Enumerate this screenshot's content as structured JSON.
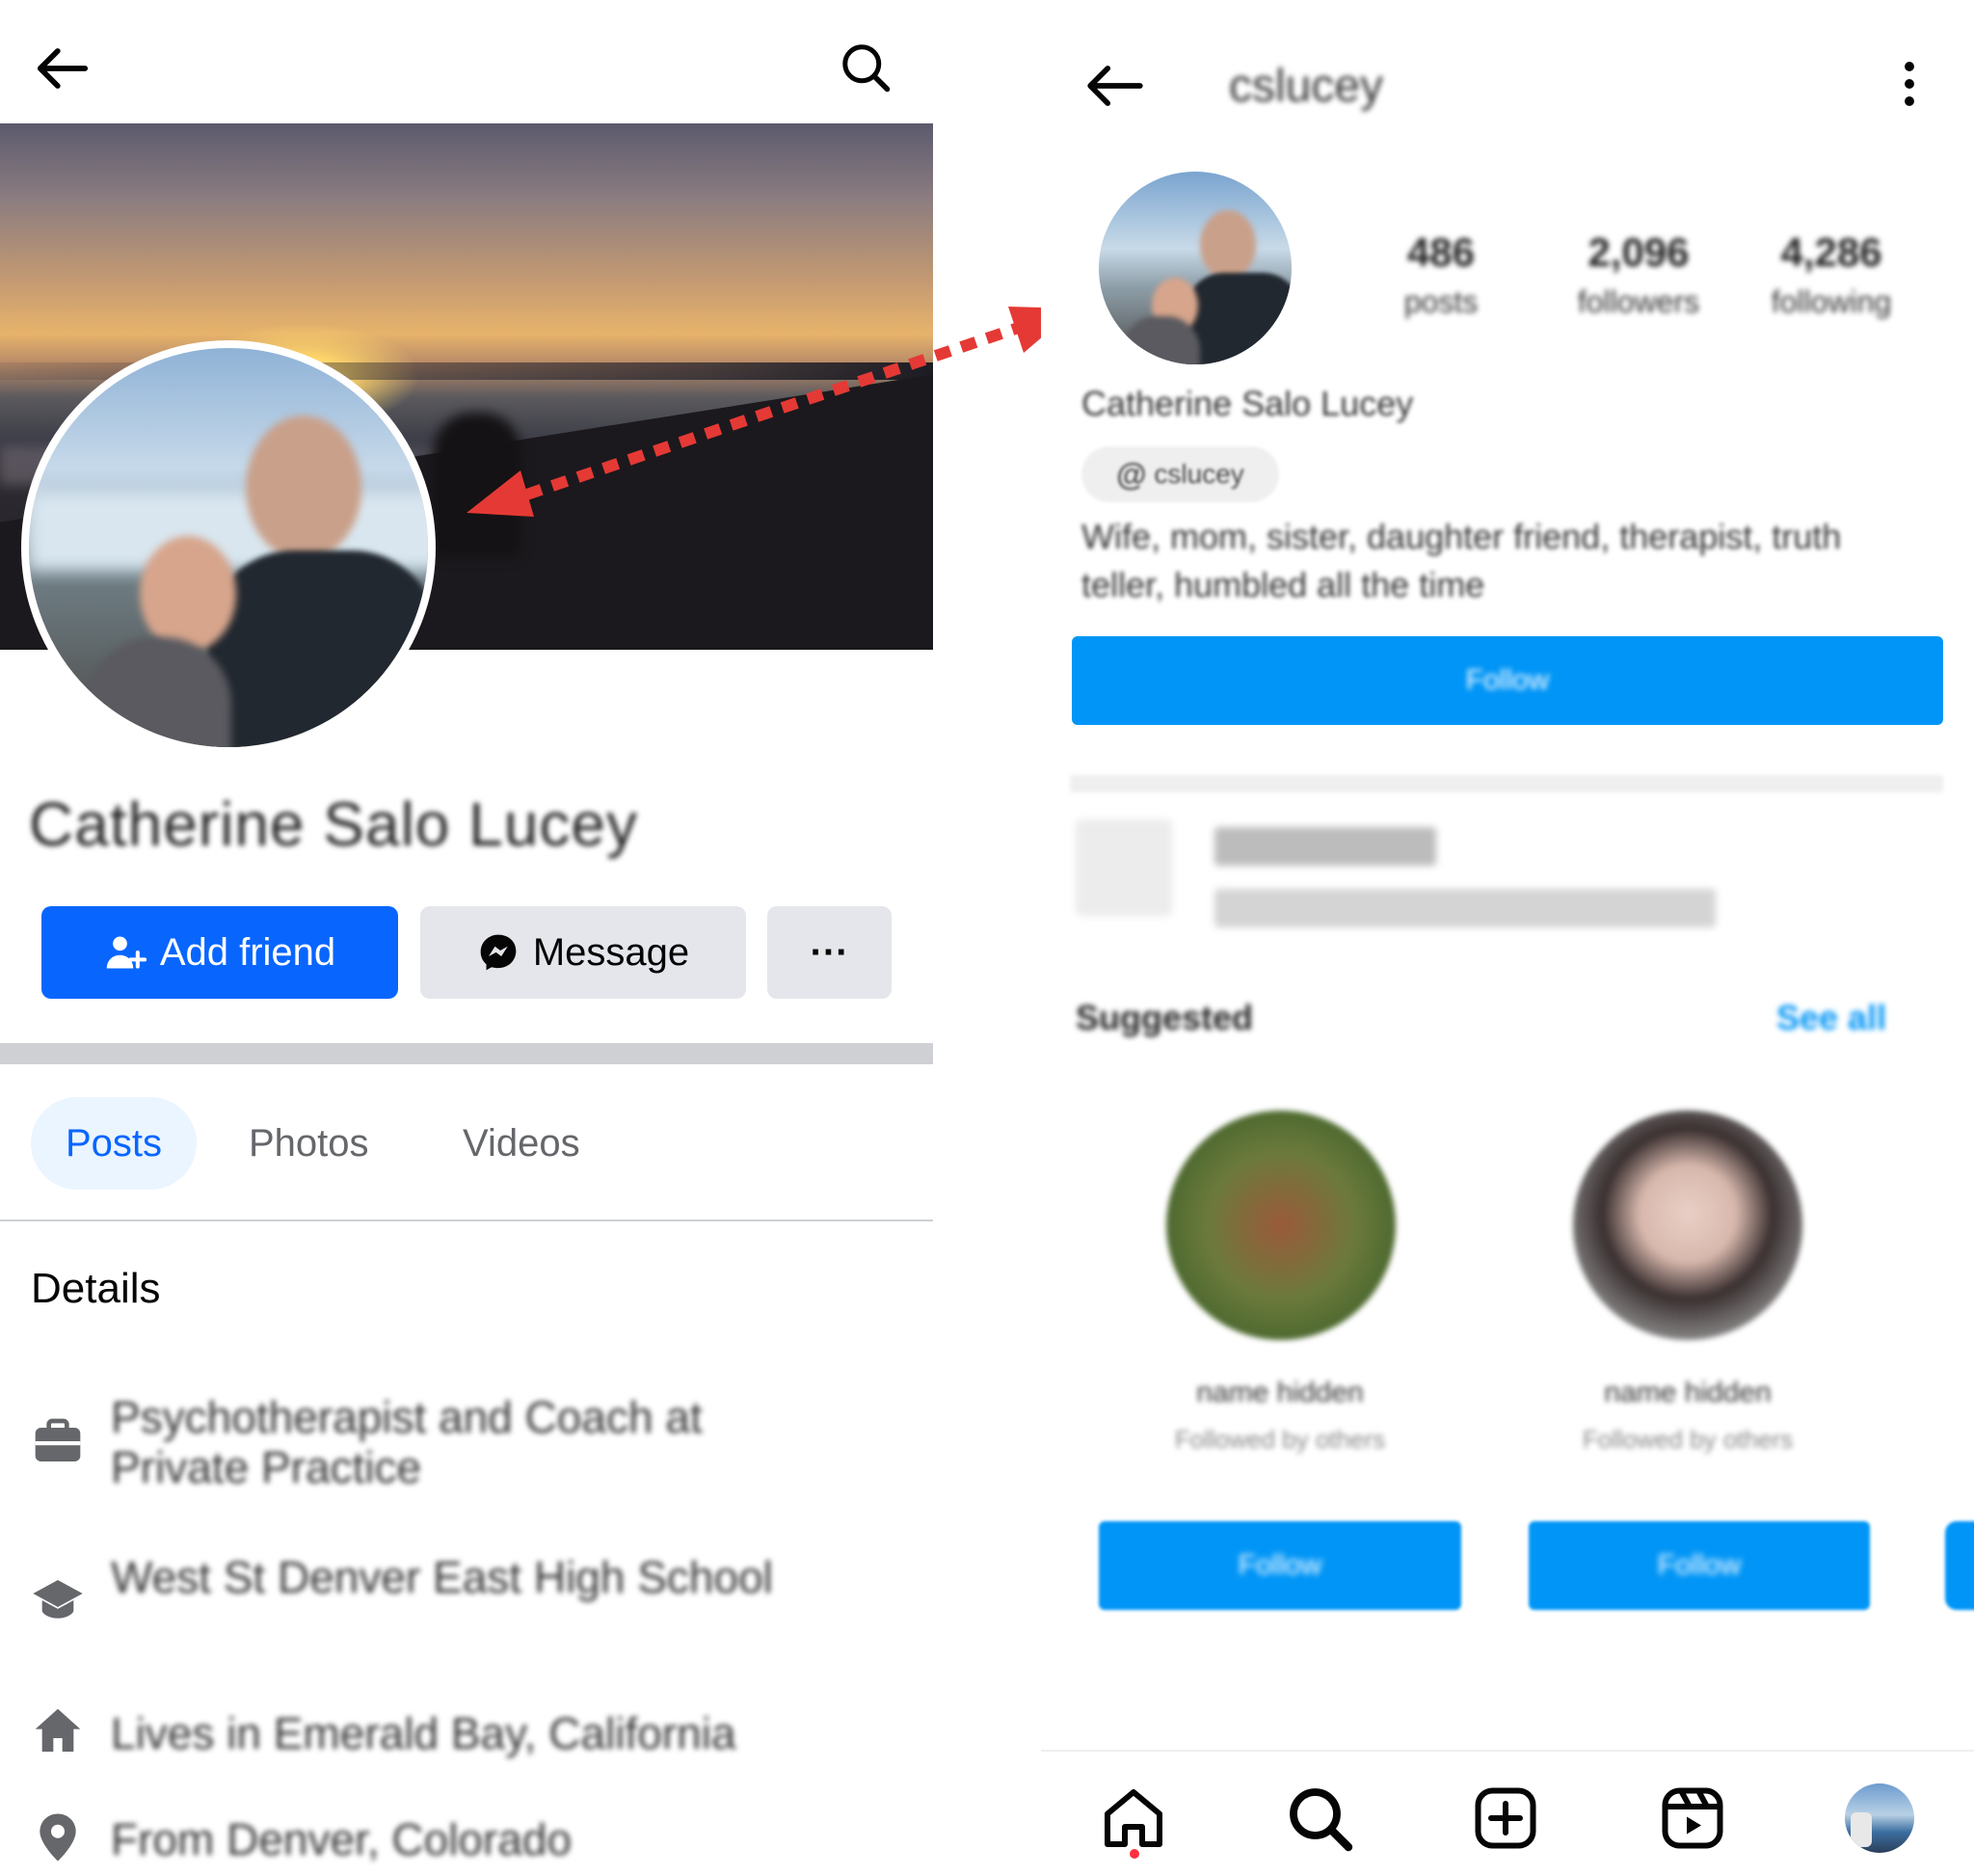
{
  "facebook": {
    "profile_name": "Catherine Salo Lucey",
    "buttons": {
      "add_friend": "Add friend",
      "message": "Message",
      "more": "···"
    },
    "tabs": [
      {
        "label": "Posts",
        "active": true
      },
      {
        "label": "Photos",
        "active": false
      },
      {
        "label": "Videos",
        "active": false
      }
    ],
    "details_title": "Details",
    "details": [
      {
        "icon": "briefcase-icon",
        "text": "Psychotherapist and Coach at Private Practice"
      },
      {
        "icon": "graduation-cap-icon",
        "text": "West St Denver East High School"
      },
      {
        "icon": "home-icon",
        "text": "Lives in Emerald Bay, California"
      },
      {
        "icon": "location-pin-icon",
        "text": "From Denver, Colorado"
      }
    ],
    "colors": {
      "accent": "#0866ff",
      "tab_bg": "#ebf5ff",
      "button_grey": "#e4e6eb"
    }
  },
  "instagram": {
    "username": "cslucey",
    "stats": [
      {
        "value": "486",
        "label": "posts"
      },
      {
        "value": "2,096",
        "label": "followers"
      },
      {
        "value": "4,286",
        "label": "following"
      }
    ],
    "full_name": "Catherine Salo Lucey",
    "threads_handle": "cslucey",
    "bio": "Wife, mom, sister, daughter friend, therapist, truth teller, humbled all the time",
    "follow_button": "Follow",
    "suggested_title": "Suggested",
    "see_all": "See all",
    "suggestions": [
      {
        "name": "name hidden",
        "sub": "Followed by others",
        "button": "Follow"
      },
      {
        "name": "name hidden",
        "sub": "Followed by others",
        "button": "Follow"
      }
    ],
    "bottom_nav": [
      "home-icon",
      "search-icon",
      "create-icon",
      "reels-icon",
      "profile-avatar"
    ],
    "colors": {
      "accent": "#0095f6",
      "notification_dot": "#ff3040"
    }
  },
  "annotation": {
    "arrow_color": "#e53935",
    "style": "dotted double-headed arrow linking the two profile photos"
  }
}
